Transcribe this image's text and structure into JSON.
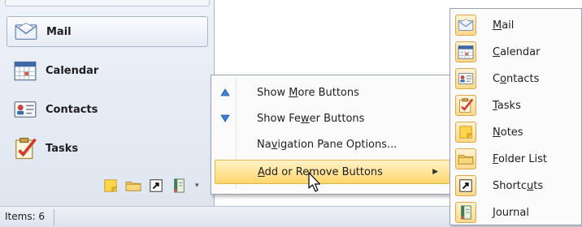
{
  "nav_pane": {
    "buttons": [
      {
        "label": "Mail",
        "icon": "mail-icon",
        "selected": true
      },
      {
        "label": "Calendar",
        "icon": "calendar-icon",
        "selected": false
      },
      {
        "label": "Contacts",
        "icon": "contacts-icon",
        "selected": false
      },
      {
        "label": "Tasks",
        "icon": "tasks-icon",
        "selected": false
      }
    ],
    "mini_icons": [
      "notes-icon",
      "folder-icon",
      "shortcut-icon",
      "journal-icon",
      "chevron-down-icon"
    ]
  },
  "status_bar": {
    "items_label": "Items: 6"
  },
  "context_menu": {
    "items": [
      {
        "label_pre": "Show ",
        "accel": "M",
        "label_post": "ore Buttons",
        "icon": "arrow-up-icon"
      },
      {
        "label_pre": "Show Fe",
        "accel": "w",
        "label_post": "er Buttons",
        "icon": "arrow-down-icon"
      },
      {
        "label_pre": "Na",
        "accel": "v",
        "label_post": "igation Pane Options...",
        "icon": ""
      },
      {
        "label_pre": "",
        "accel": "A",
        "label_post": "dd or Remove Buttons",
        "icon": "",
        "highlighted": true,
        "has_submenu": true
      }
    ]
  },
  "submenu": {
    "items": [
      {
        "label_pre": "",
        "accel": "M",
        "label_post": "ail",
        "icon": "mail-icon",
        "checked": true
      },
      {
        "label_pre": "",
        "accel": "C",
        "label_post": "alendar",
        "icon": "calendar-icon",
        "checked": true
      },
      {
        "label_pre": "C",
        "accel": "o",
        "label_post": "ntacts",
        "icon": "contacts-icon",
        "checked": true
      },
      {
        "label_pre": "",
        "accel": "T",
        "label_post": "asks",
        "icon": "tasks-icon",
        "checked": true
      },
      {
        "label_pre": "",
        "accel": "N",
        "label_post": "otes",
        "icon": "notes-icon",
        "checked": true
      },
      {
        "label_pre": "",
        "accel": "F",
        "label_post": "older List",
        "icon": "folder-icon",
        "checked": true
      },
      {
        "label_pre": "Shortc",
        "accel": "u",
        "label_post": "ts",
        "icon": "shortcut-icon",
        "checked": true
      },
      {
        "label_pre": "",
        "accel": "J",
        "label_post": "ournal",
        "icon": "journal-icon",
        "checked": true
      }
    ]
  },
  "colors": {
    "highlight_top": "#fff3c8",
    "highlight_bottom": "#ffd66e",
    "highlight_border": "#e3b84a",
    "accent_blue": "#3c7fd4"
  }
}
